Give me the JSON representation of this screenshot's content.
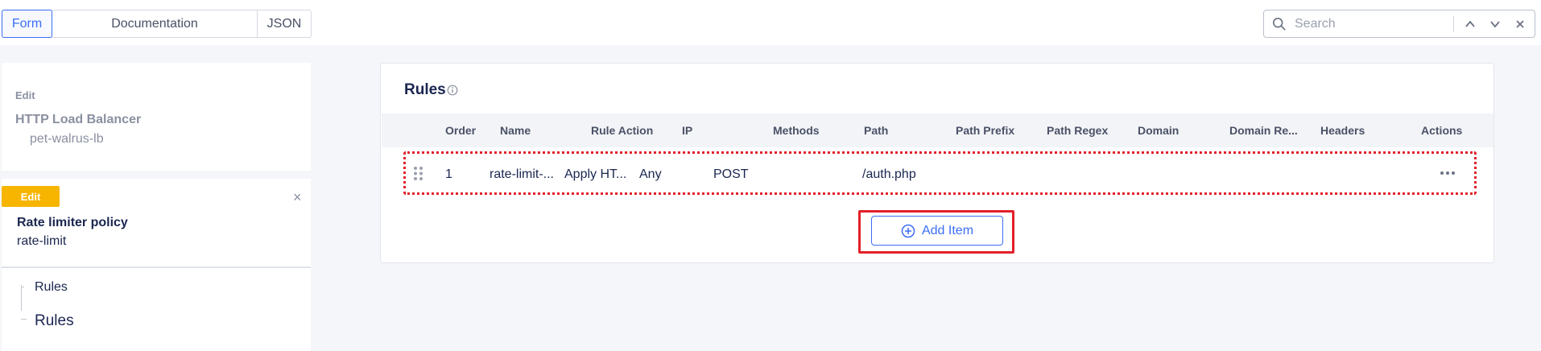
{
  "tabs": [
    {
      "label": "Form",
      "active": true
    },
    {
      "label": "Documentation",
      "active": false
    },
    {
      "label": "JSON",
      "active": false
    }
  ],
  "search": {
    "placeholder": "Search"
  },
  "load_balancer": {
    "edit_label": "Edit",
    "type": "HTTP Load Balancer",
    "name": "pet-walrus-lb"
  },
  "policy": {
    "badge": "Edit",
    "type": "Rate limiter policy",
    "name": "rate-limit",
    "close": "×"
  },
  "tree": {
    "items": [
      "Rules",
      "Rules"
    ]
  },
  "rules": {
    "title": "Rules",
    "columns": [
      "Order",
      "Name",
      "Rule Action",
      "IP",
      "Methods",
      "Path",
      "Path Prefix",
      "Path Regex",
      "Domain",
      "Domain Re...",
      "Headers",
      "Actions"
    ],
    "rows": [
      {
        "order": "1",
        "name": "rate-limit-...",
        "rule_action": "Apply HT...",
        "ip": "Any",
        "methods": "POST",
        "path": "",
        "path_prefix": "/auth.php",
        "path_regex": "",
        "domain": "",
        "domain_regex": "",
        "headers": ""
      }
    ],
    "add_button": "Add Item"
  },
  "colors": {
    "accent": "#3b6ef5",
    "highlight": "#e2202a",
    "badge": "#f7b500"
  }
}
